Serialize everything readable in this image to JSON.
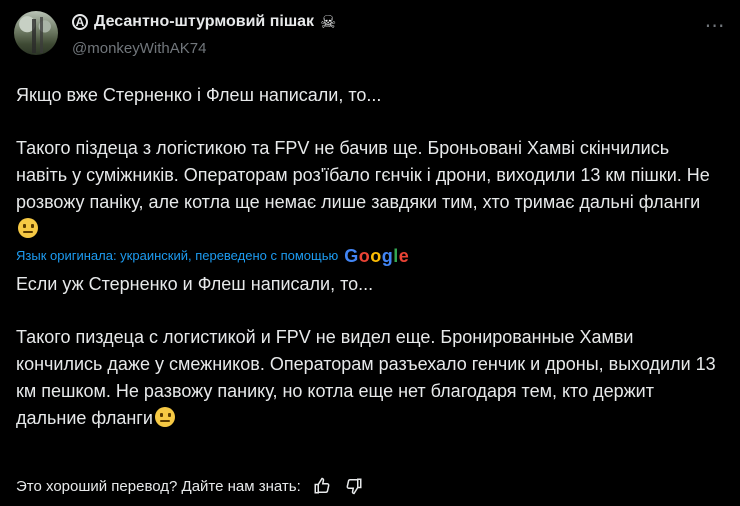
{
  "author": {
    "display_name": "Десантно-штурмовий пішак",
    "handle": "@monkeyWithAK74",
    "badge_left_icon": "anarchy-icon",
    "badge_right_icon": "skull-icon"
  },
  "post": {
    "original": {
      "p1": "Якщо вже Стерненко і Флеш написали, то...",
      "p2": "Такого піздеца з логістикою та FPV не бачив ще. Броньовані Хамві скінчились навіть у суміжників. Операторам роз'їбало гєнчік і дрони, виходили 13 км пішки. Не розвожу паніку, але котла ще немає лише завдяки тим, хто тримає дальні фланги"
    },
    "translation_notice": "Язык оригинала: украинский, переведено с помощью",
    "translation_provider": "Google",
    "translated": {
      "p1": "Если уж Стерненко и Флеш написали, то...",
      "p2": "Такого пиздеца с логистикой и FPV не видел еще. Бронированные Хамви кончились даже у смежников. Операторам разъехало генчик и дроны, выходили 13 км пешком. Не развожу панику, но котла еще нет благодаря тем, кто держит дальние фланги"
    }
  },
  "feedback": {
    "question": "Это хороший перевод? Дайте нам знать:",
    "thumbs_up_icon": "thumbs-up-icon",
    "thumbs_down_icon": "thumbs-down-icon"
  },
  "menu_icon": "more-horizontal-icon"
}
